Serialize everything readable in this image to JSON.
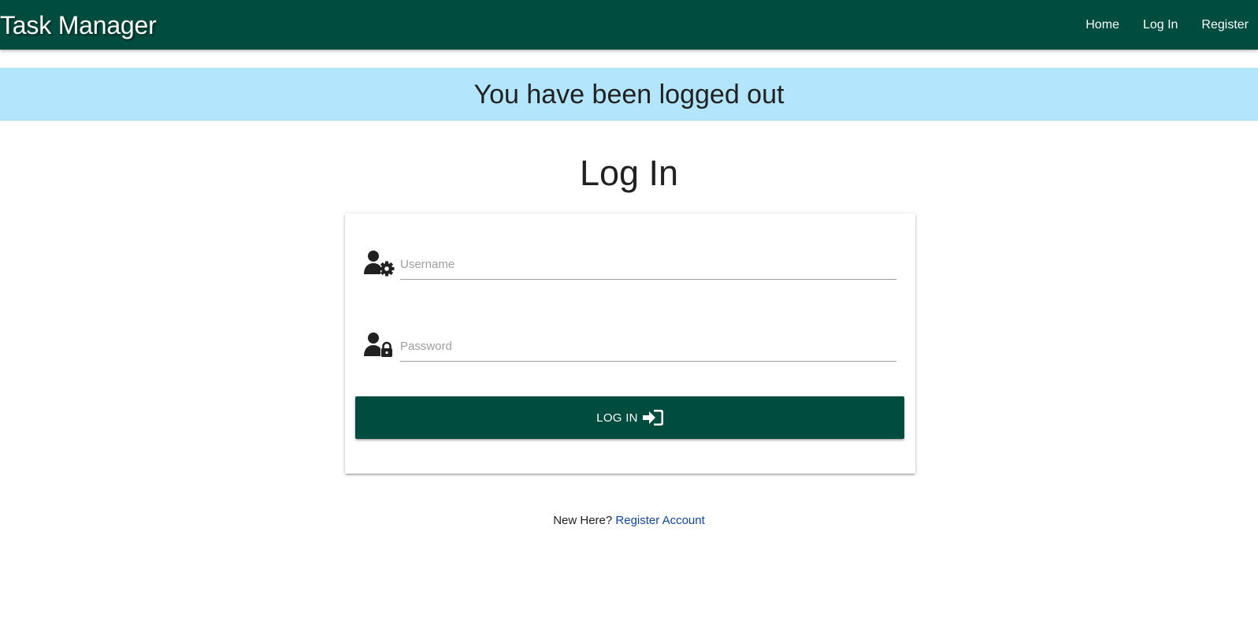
{
  "navbar": {
    "brand": "Task Manager",
    "links": [
      {
        "label": "Home"
      },
      {
        "label": "Log In"
      },
      {
        "label": "Register"
      }
    ],
    "color": "#004d40"
  },
  "flash": {
    "message": "You have been logged out",
    "color": "#b3e5fc"
  },
  "page": {
    "title": "Log In"
  },
  "form": {
    "username": {
      "placeholder": "Username",
      "value": "",
      "icon": "user-gear-icon"
    },
    "password": {
      "placeholder": "Password",
      "value": "",
      "icon": "user-lock-icon"
    },
    "submit": {
      "label": "LOG IN",
      "icon": "sign-in-icon"
    }
  },
  "footer": {
    "prompt": "New Here?",
    "register_link": "Register Account",
    "link_color": "#0d47a1"
  }
}
